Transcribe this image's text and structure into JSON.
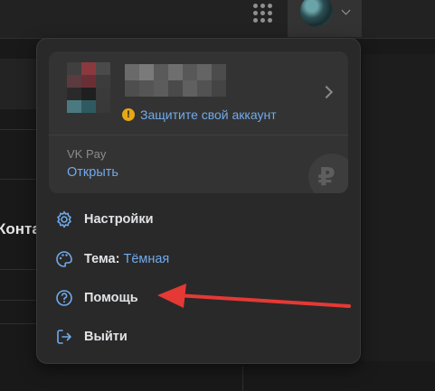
{
  "background": {
    "partial_text": "Конта"
  },
  "topbar": {
    "apps_icon": "grid-icon",
    "profile_chevron": "chevron-down-icon"
  },
  "account": {
    "warning": "Защитите свой аккаунт",
    "warning_icon": "exclamation-icon"
  },
  "vkpay": {
    "label": "VK Pay",
    "action": "Открыть",
    "icon_glyph": "₽"
  },
  "menu": {
    "settings": "Настройки",
    "theme_label": "Тема:",
    "theme_value": "Тёмная",
    "help": "Помощь",
    "logout": "Выйти"
  },
  "colors": {
    "accent": "#71aaeb",
    "warning": "#e6a817",
    "annotation_arrow": "#e53935"
  }
}
